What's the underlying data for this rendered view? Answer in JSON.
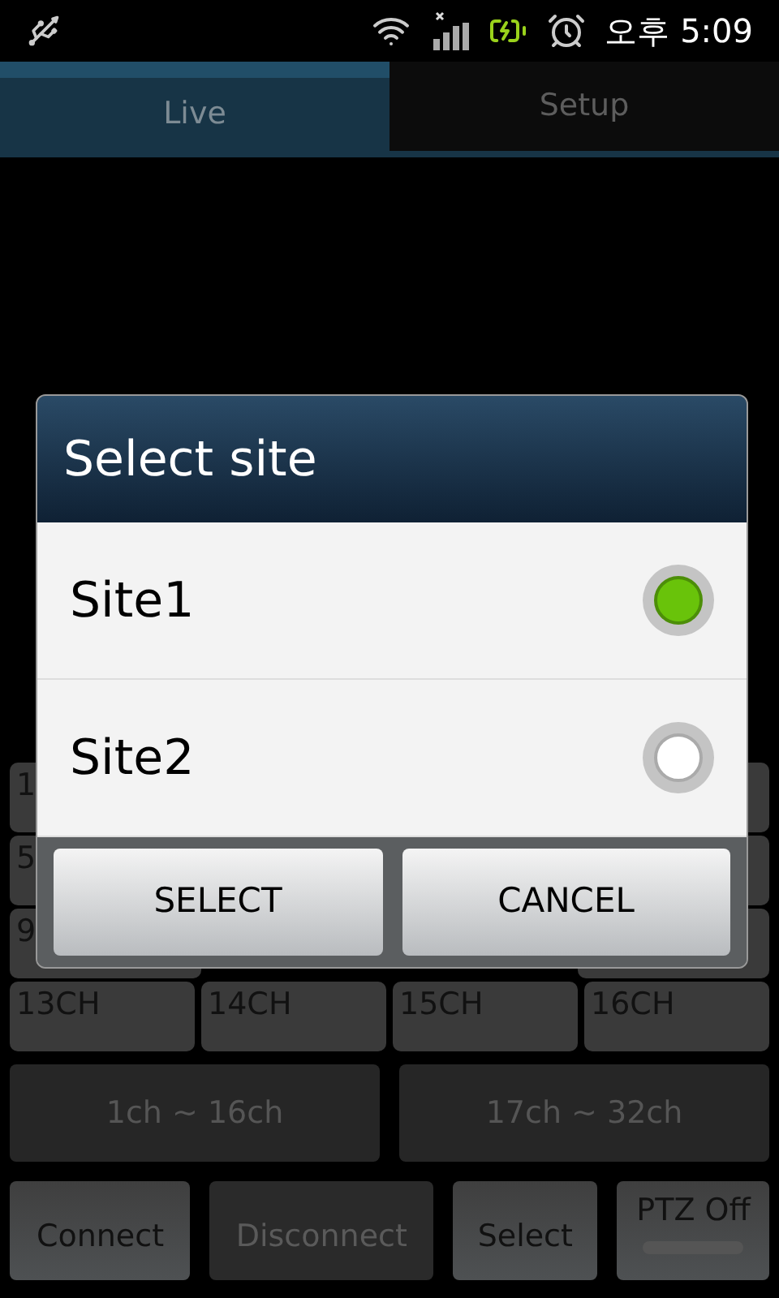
{
  "status_bar": {
    "time": "오후 5:09"
  },
  "tabs": [
    {
      "label": "Live",
      "selected": true
    },
    {
      "label": "Setup",
      "selected": false
    }
  ],
  "channel_rows": [
    {
      "cells": [
        "1"
      ]
    },
    {
      "cells": [
        "5"
      ]
    },
    {
      "cells": [
        "9"
      ]
    },
    {
      "cells": [
        "13CH",
        "14CH",
        "15CH",
        "16CH"
      ]
    }
  ],
  "range_buttons": [
    {
      "label": "1ch ~ 16ch",
      "disabled": true
    },
    {
      "label": "17ch ~ 32ch",
      "disabled": true
    }
  ],
  "action_buttons": [
    {
      "kind": "button",
      "label": "Connect",
      "disabled": false
    },
    {
      "kind": "button",
      "label": "Disconnect",
      "disabled": true
    },
    {
      "kind": "button",
      "label": "Select",
      "disabled": false
    },
    {
      "kind": "toggle",
      "label": "PTZ Off",
      "on": false
    }
  ],
  "dialog": {
    "title": "Select site",
    "options": [
      {
        "label": "Site1",
        "selected": true
      },
      {
        "label": "Site2",
        "selected": false
      }
    ],
    "buttons": [
      "SELECT",
      "CANCEL"
    ]
  }
}
